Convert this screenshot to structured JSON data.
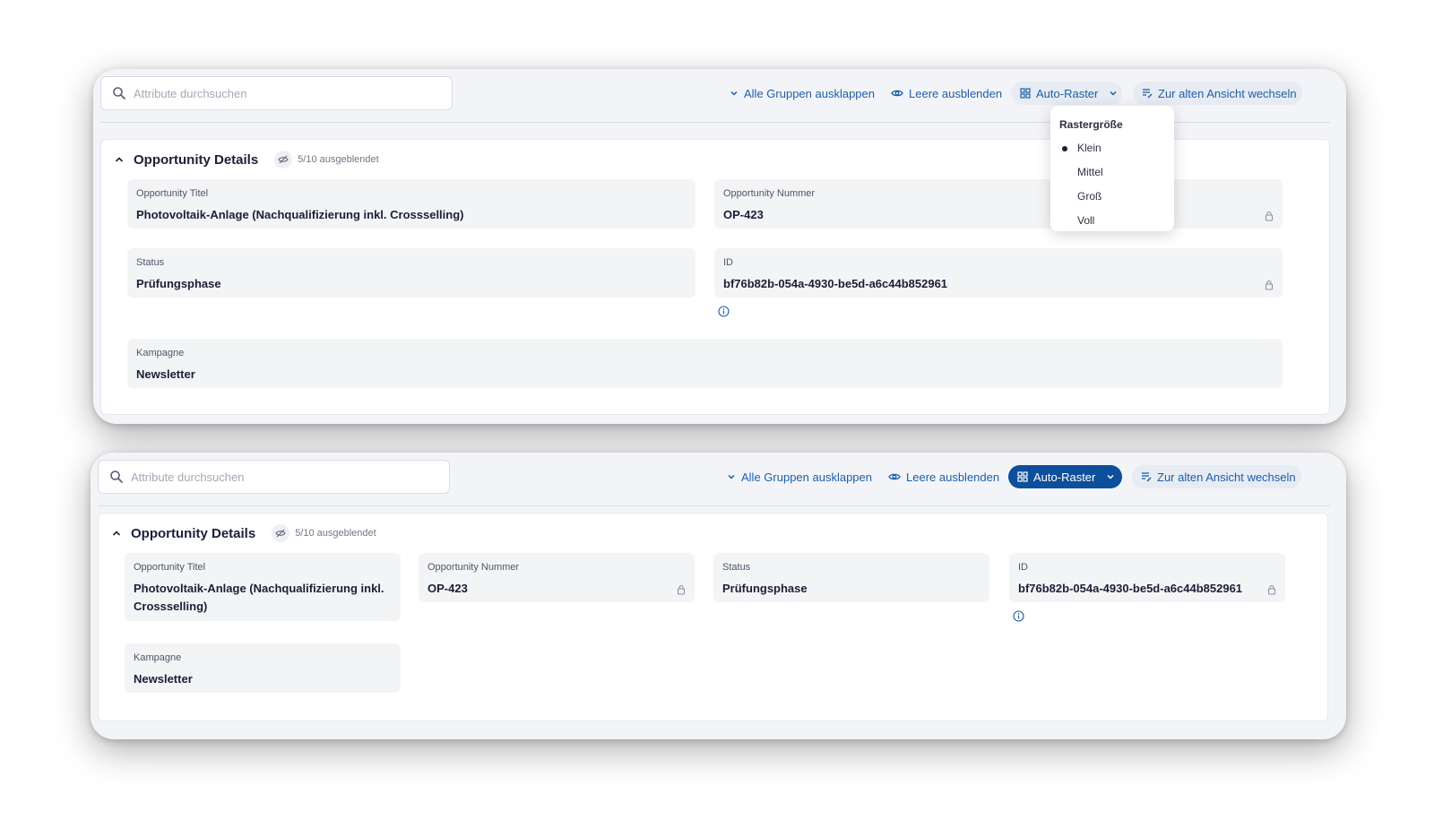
{
  "colors": {
    "accent": "#1d5fa8",
    "accent_active": "#0d4f9a",
    "field_bg": "#f3f4f6",
    "panel_bg": "#f3f4f8"
  },
  "icons": {
    "search": "search-icon",
    "chevron_down": "chevron-down-icon",
    "eye": "eye-icon",
    "grid": "grid-icon",
    "switch_view": "list-edit-icon",
    "chevron_up": "chevron-up-icon",
    "eye_off": "eye-off-icon",
    "lock": "lock-icon",
    "info": "info-icon"
  },
  "toolbar": {
    "search_placeholder": "Attribute durchsuchen",
    "expand_all_label": "Alle Gruppen ausklappen",
    "hide_empty_label": "Leere ausblenden",
    "grid_label": "Auto-Raster",
    "switch_view_label": "Zur alten Ansicht wechseln"
  },
  "grid_dropdown": {
    "title": "Rastergröße",
    "options": [
      "Klein",
      "Mittel",
      "Groß",
      "Voll"
    ],
    "selected": "Klein"
  },
  "group": {
    "title": "Opportunity Details",
    "hidden_count": "5/10 ausgeblendet"
  },
  "fields": {
    "title": {
      "label": "Opportunity Titel",
      "value": "Photovoltaik-Anlage (Nachqualifizierung inkl. Crossselling)"
    },
    "number": {
      "label": "Opportunity Nummer",
      "value": "OP-423"
    },
    "status": {
      "label": "Status",
      "value": "Prüfungsphase"
    },
    "id": {
      "label": "ID",
      "value": "bf76b82b-054a-4930-be5d-a6c44b852961"
    },
    "campaign": {
      "label": "Kampagne",
      "value": "Newsletter"
    }
  },
  "panel2_fields": {
    "title_line1": "Photovoltaik-Anlage (Nachqualifizierung inkl.",
    "title_line2": "Crossselling)"
  }
}
